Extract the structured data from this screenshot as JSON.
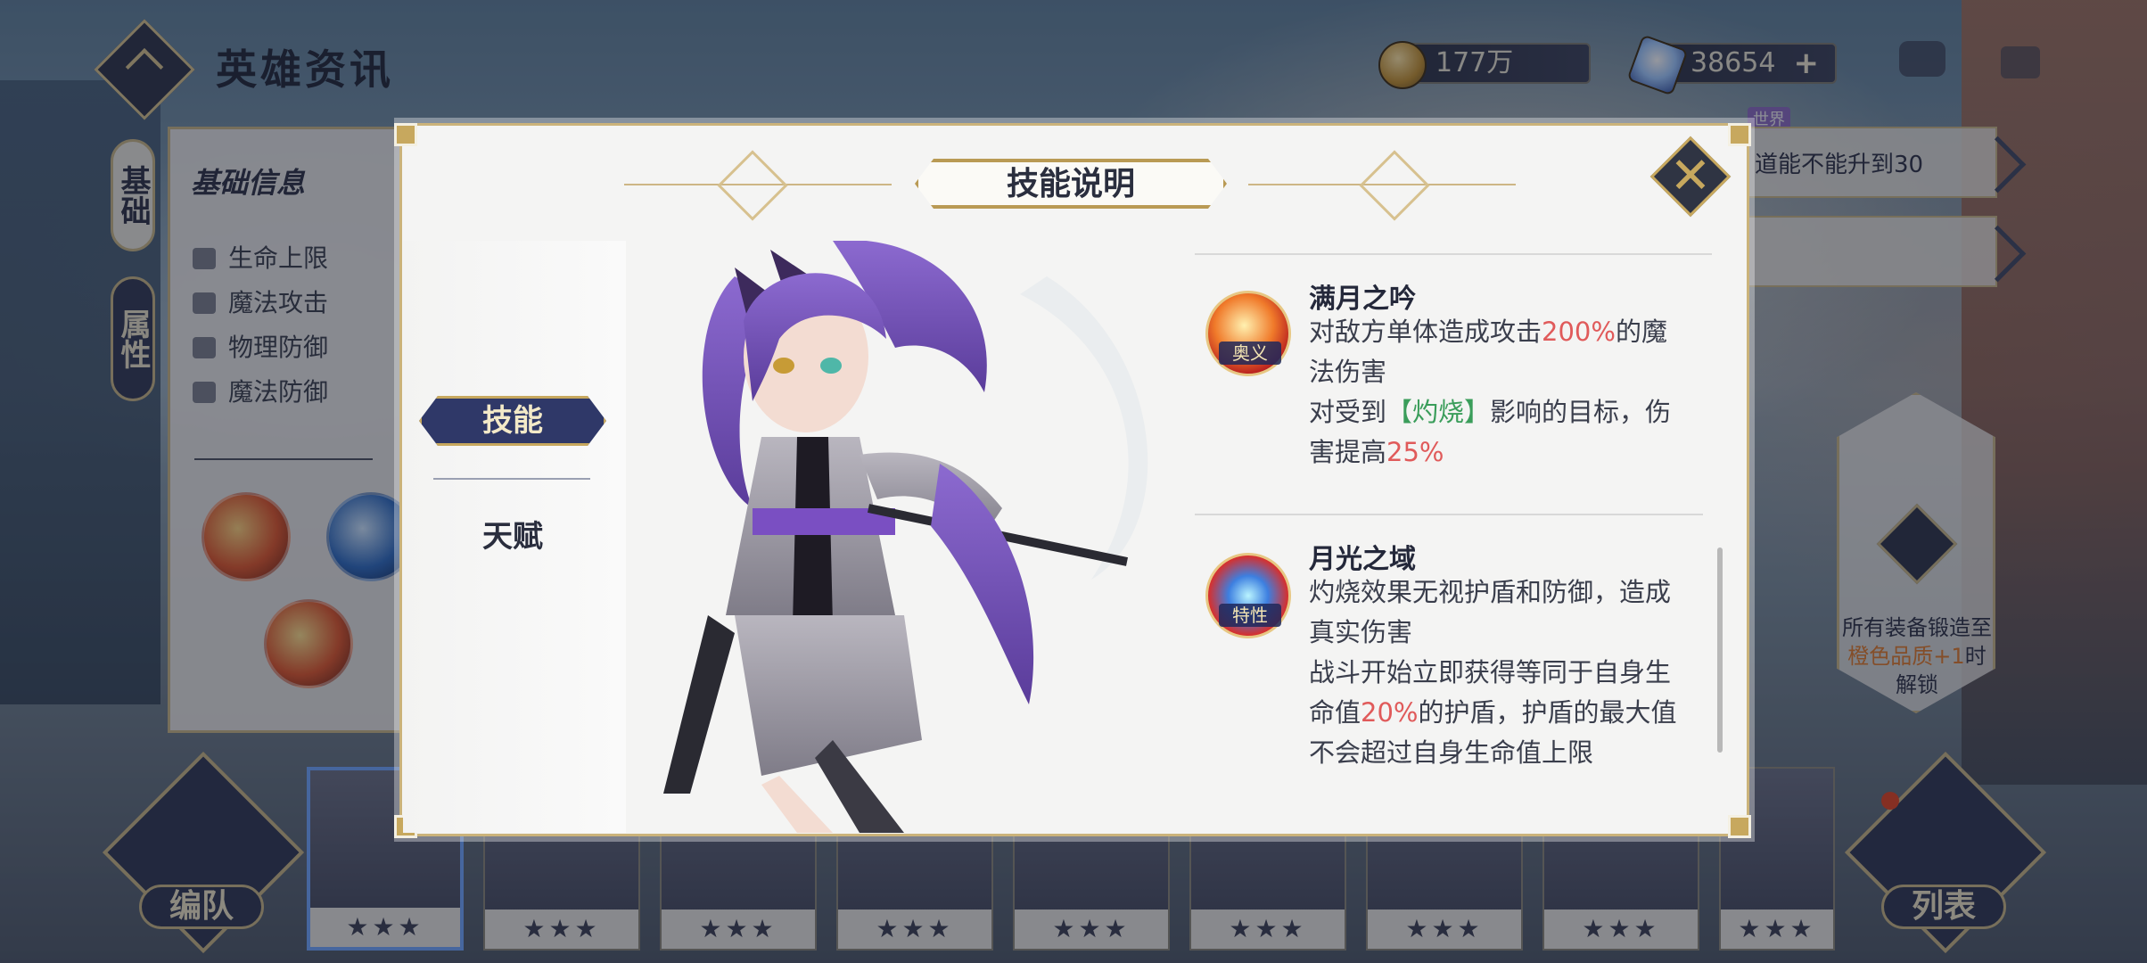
{
  "header": {
    "title": "英雄资讯",
    "gold": "177万",
    "gems": "38654",
    "gems_plus": "+"
  },
  "left_panel": {
    "tab_basic": "基础",
    "tab_attr": "属性",
    "section_title": "基础信息",
    "rows": [
      "生命上限",
      "魔法攻击",
      "物理防御",
      "魔法防御"
    ]
  },
  "right_panel": {
    "bar1_text": "道能不能升到30",
    "world_badge": "世界",
    "lock_text_1": "所有装备锻造至",
    "lock_text_2": "橙色品质+1",
    "lock_text_3": "时解锁"
  },
  "bottom": {
    "team_button": "编队",
    "list_button": "列表",
    "hero_cards": [
      {
        "stars": "★★★",
        "selected": true
      },
      {
        "stars": "★★★",
        "selected": false
      },
      {
        "stars": "★★★",
        "selected": false
      },
      {
        "stars": "★★★",
        "selected": false
      },
      {
        "stars": "★★★",
        "selected": false
      },
      {
        "stars": "★★★",
        "selected": false
      },
      {
        "stars": "★★★",
        "selected": false
      },
      {
        "stars": "★★★",
        "selected": false
      },
      {
        "stars": "★★★",
        "selected": false
      }
    ]
  },
  "modal": {
    "title": "技能说明",
    "tab_skill": "技能",
    "tab_talent": "天赋",
    "close": "✕",
    "skills": [
      {
        "name": "满月之吟",
        "tag": "奥义",
        "desc_1_a": "对敌方单体造成攻击",
        "desc_1_hl": "200%",
        "desc_1_b": "的魔法伤害",
        "desc_2_a": "对受到",
        "desc_2_hl": "【灼烧】",
        "desc_2_b": "影响的目标，伤害提高",
        "desc_2_hl2": "25%"
      },
      {
        "name": "月光之域",
        "tag": "特性",
        "desc_1_a": "灼烧效果无视护盾和防御，造成真实伤害",
        "desc_2_a": "战斗开始立即获得等同于自身生命值",
        "desc_2_hl": "20%",
        "desc_2_b": "的护盾，护盾的最大值不会超过自身生命值上限"
      }
    ]
  },
  "colors": {
    "accent_gold": "#c7a85e",
    "navy": "#2f3868",
    "highlight_red": "#e05a5a",
    "highlight_green": "#3a9d5a"
  }
}
